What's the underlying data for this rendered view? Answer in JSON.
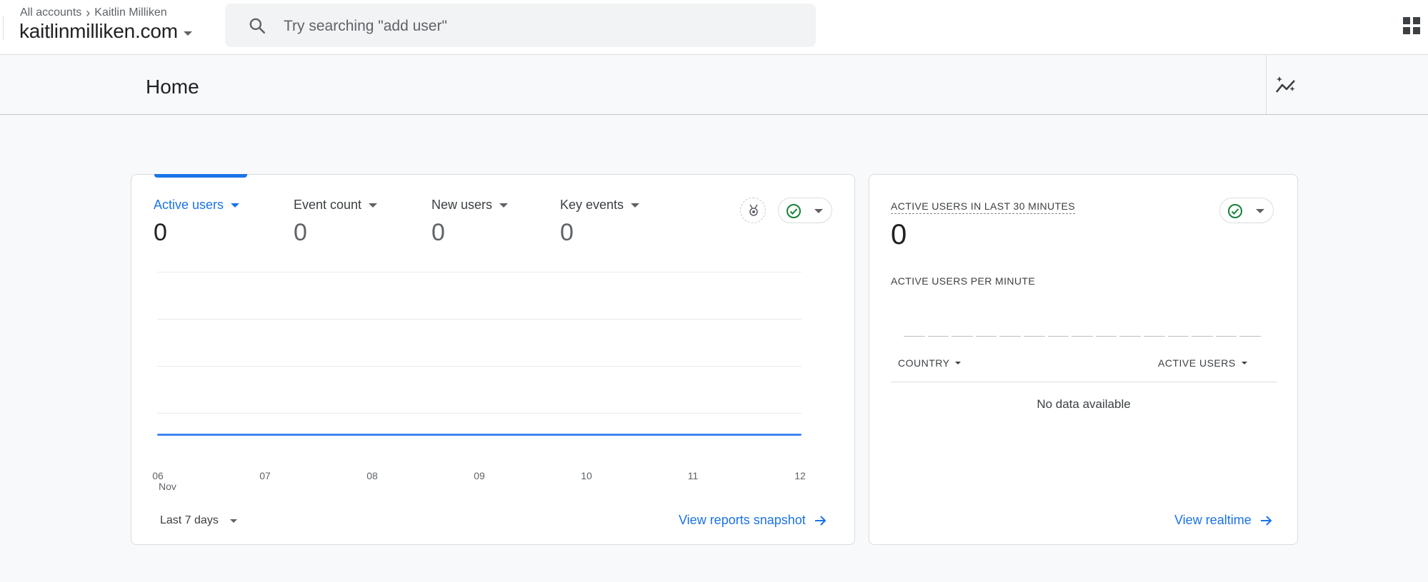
{
  "breadcrumb": {
    "account": "All accounts",
    "separator": "›",
    "property": "Kaitlin Milliken"
  },
  "property_name": "kaitlinmilliken.com",
  "search": {
    "placeholder": "Try searching \"add user\""
  },
  "page": {
    "title": "Home"
  },
  "overview_card": {
    "metrics": [
      {
        "label": "Active users",
        "value": "0",
        "selected": true
      },
      {
        "label": "Event count",
        "value": "0"
      },
      {
        "label": "New users",
        "value": "0"
      },
      {
        "label": "Key events",
        "value": "0"
      }
    ],
    "x_ticks": [
      "06",
      "07",
      "08",
      "09",
      "10",
      "11",
      "12"
    ],
    "x_sub": "Nov",
    "date_range": "Last 7 days",
    "link": "View reports snapshot"
  },
  "realtime_card": {
    "title": "ACTIVE USERS IN LAST 30 MINUTES",
    "value": "0",
    "subtitle": "ACTIVE USERS PER MINUTE",
    "columns": [
      "COUNTRY",
      "ACTIVE USERS"
    ],
    "empty_text": "No data available",
    "link": "View realtime"
  },
  "colors": {
    "accent": "#1a73e8",
    "success": "#188038",
    "line": "#4285f4"
  },
  "chart_data": {
    "type": "line",
    "categories": [
      "06 Nov",
      "07",
      "08",
      "09",
      "10",
      "11",
      "12"
    ],
    "series": [
      {
        "name": "Active users",
        "values": [
          0,
          0,
          0,
          0,
          0,
          0,
          0
        ]
      }
    ]
  }
}
